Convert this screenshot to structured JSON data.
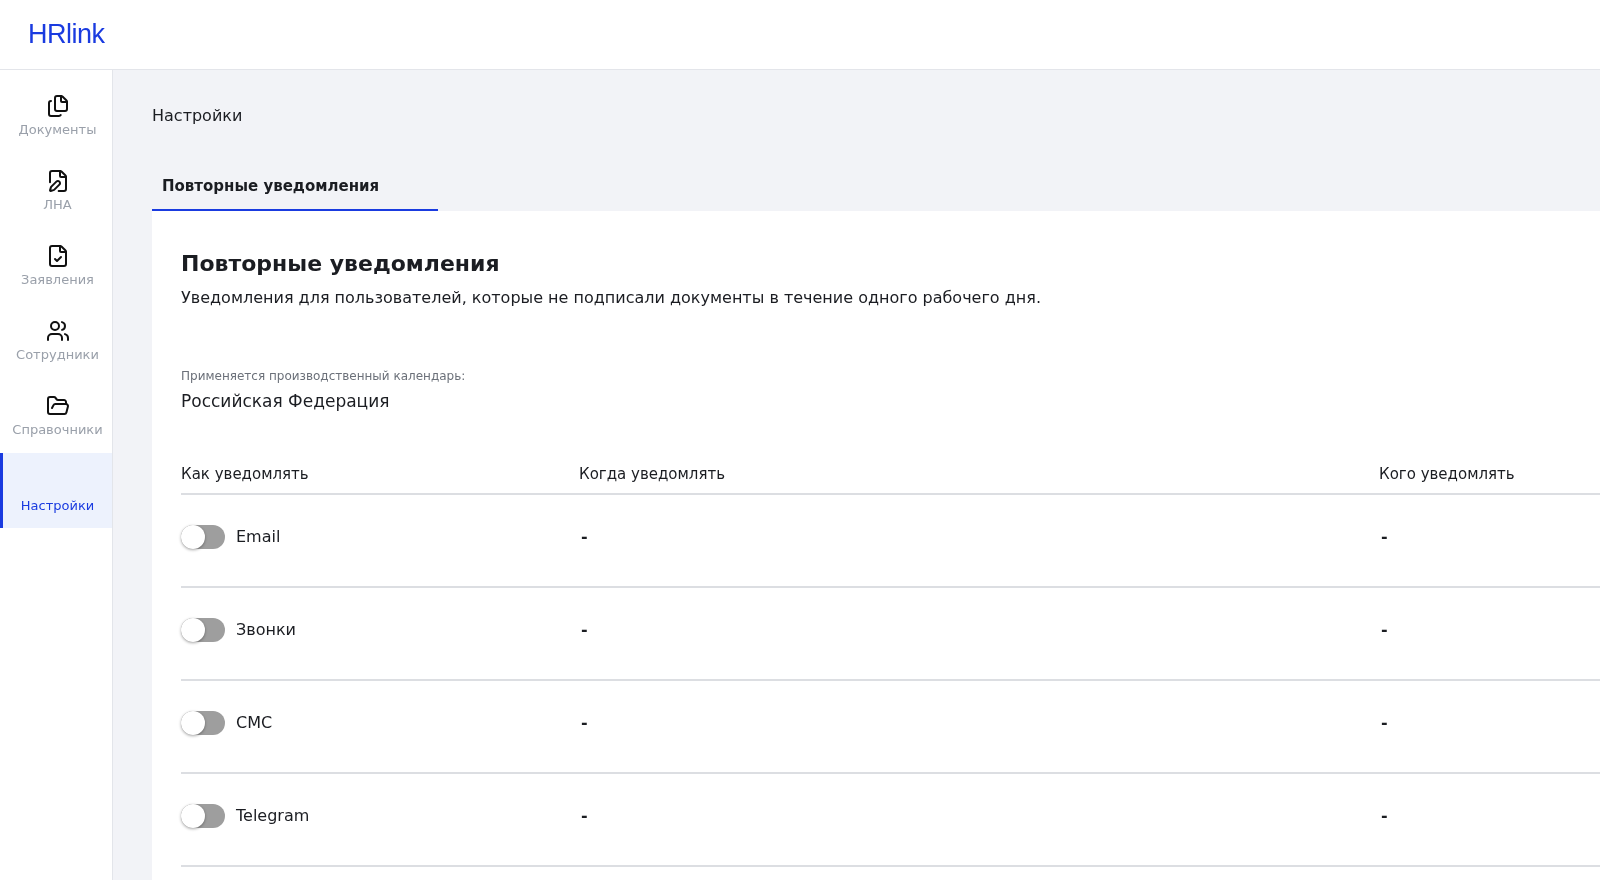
{
  "logo": "HRlink",
  "sidebar": {
    "items": [
      {
        "label": "Документы",
        "selected": false
      },
      {
        "label": "ЛНА",
        "selected": false
      },
      {
        "label": "Заявления",
        "selected": false
      },
      {
        "label": "Сотрудники",
        "selected": false
      },
      {
        "label": "Справочники",
        "selected": false
      },
      {
        "label": "Настройки",
        "selected": true
      }
    ]
  },
  "page_title": "Настройки",
  "tabs": [
    {
      "label": "Повторные уведомления",
      "selected": true
    }
  ],
  "section": {
    "title": "Повторные уведомления",
    "description": "Уведомления для пользователей, которые не подписали документы в течение одного рабочего дня.",
    "calendar_label": "Применяется производственный календарь:",
    "calendar_value": "Российская Федерация"
  },
  "table": {
    "columns": [
      "Как уведомлять",
      "Когда уведомлять",
      "Кого уведомлять"
    ],
    "rows": [
      {
        "channel": "Email",
        "on": false,
        "when": "-",
        "whom": "-"
      },
      {
        "channel": "Звонки",
        "on": false,
        "when": "-",
        "whom": "-"
      },
      {
        "channel": "СМС",
        "on": false,
        "when": "-",
        "whom": "-"
      },
      {
        "channel": "Telegram",
        "on": false,
        "when": "-",
        "whom": "-"
      }
    ]
  }
}
